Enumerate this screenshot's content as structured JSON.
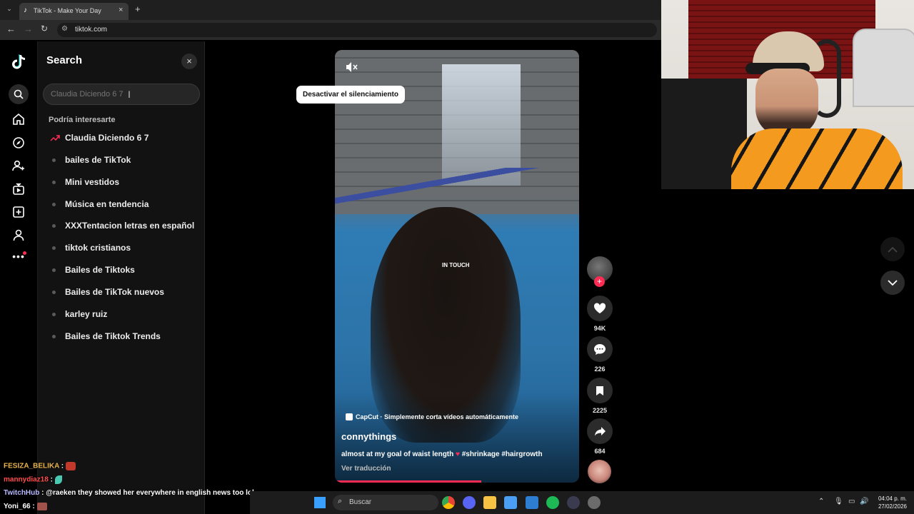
{
  "browser": {
    "tab_title": "TikTok - Make Your Day",
    "url": "tiktok.com"
  },
  "search_panel": {
    "title": "Search",
    "input_placeholder": "Claudia Diciendo 6 7",
    "section_label": "Podría interesarte",
    "suggestions": [
      {
        "label": "Claudia Diciendo 6 7",
        "trending": true
      },
      {
        "label": "bailes de TikTok"
      },
      {
        "label": "Mini vestidos"
      },
      {
        "label": "Música en tendencia"
      },
      {
        "label": "XXXTentacion letras en español"
      },
      {
        "label": "tiktok cristianos"
      },
      {
        "label": "Bailes de Tiktoks"
      },
      {
        "label": "Bailes de TikTok nuevos"
      },
      {
        "label": "karley ruiz"
      },
      {
        "label": "Bailes de Tiktok Trends"
      }
    ]
  },
  "video": {
    "mute_tooltip": "Desactivar el silenciamiento",
    "center_label": "IN TOUCH",
    "capcut_text": "CapCut · Simplemente corta vídeos automáticamente",
    "author": "connythings",
    "caption": "almost at my goal of waist length",
    "hashtags": "#shrinkage #hairgrowth",
    "translate": "Ver traducción",
    "progress": 0.6
  },
  "actions": {
    "likes": "94K",
    "comments": "226",
    "saves": "2225",
    "shares": "684"
  },
  "chat": [
    {
      "user": "FESIZA_BELIKA",
      "message": "",
      "color": "#e8b44c"
    },
    {
      "user": "mannydiaz18",
      "message": "",
      "color": "#ff4b4b"
    },
    {
      "user": "TwitchHub",
      "message": "@raeken they showed her everywhere in english news too lol",
      "color": "#b9b9ff"
    },
    {
      "user": "Yoni_66",
      "message": "",
      "color": "#ffffff"
    }
  ],
  "taskbar": {
    "search_label": "Buscar",
    "time": "04:04 p. m.",
    "date": "27/02/2026"
  },
  "colors": {
    "accent": "#fe2c55",
    "panel_bg": "#121212"
  }
}
